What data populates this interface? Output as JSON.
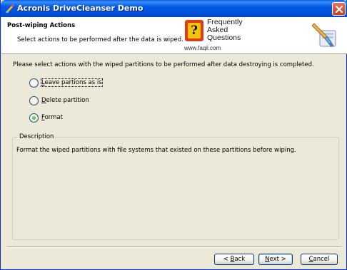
{
  "window": {
    "title": "Acronis DriveCleanser Demo"
  },
  "header": {
    "title": "Post-wiping Actions",
    "subtitle": "Select actions to be performed after the data is wiped."
  },
  "watermark": {
    "line1": "Frequently",
    "line2": "Asked",
    "line3": "Questions",
    "url": "www.faqil.com"
  },
  "intro": "Please select actions with the wiped partitions to be performed after data destroying is completed.",
  "options": [
    {
      "key": "L",
      "rest": "eave partions as is",
      "selected": false
    },
    {
      "key": "D",
      "rest": "elete partition",
      "selected": false
    },
    {
      "key": "F",
      "rest": "ormat",
      "selected": true
    }
  ],
  "description": {
    "legend": "Description",
    "text": "Format the wiped partitions with file systems that existed on these partitions before wiping."
  },
  "buttons": {
    "back": {
      "prefix": "< ",
      "key": "B",
      "rest": "ack"
    },
    "next": {
      "key": "N",
      "rest": "ext >"
    },
    "cancel": {
      "key": "C",
      "rest": "ancel"
    }
  },
  "colors": {
    "titlebar": "#0058E6",
    "dialog": "#ECE9D8",
    "close": "#C9401F",
    "radio_dot": "#21A121"
  }
}
